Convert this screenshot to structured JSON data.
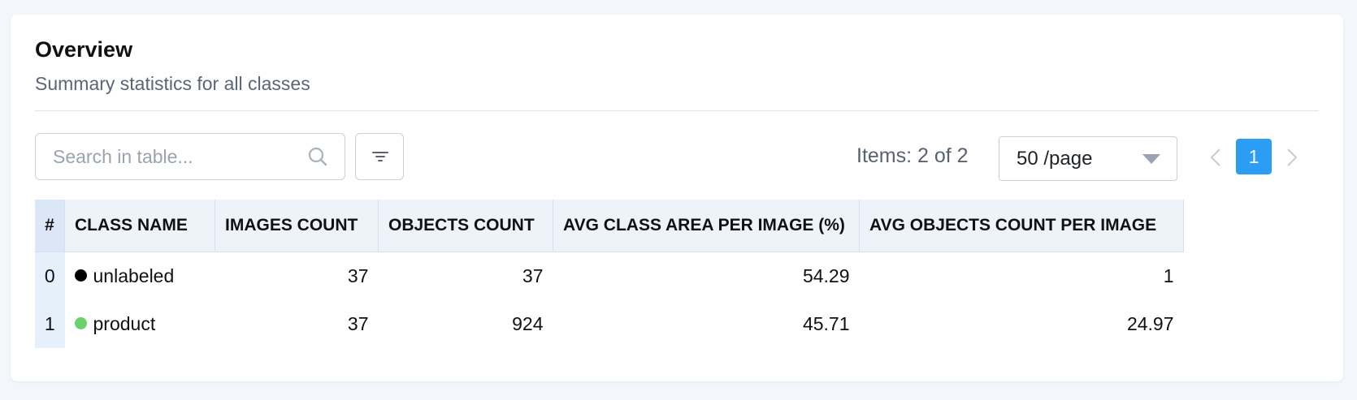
{
  "panel": {
    "title": "Overview",
    "subtitle": "Summary statistics for all classes"
  },
  "toolbar": {
    "search_placeholder": "Search in table...",
    "items_label": "Items: 2 of 2",
    "page_size": "50 /page",
    "current_page": "1"
  },
  "table": {
    "columns": {
      "index": "#",
      "class_name": "CLASS NAME",
      "images_count": "IMAGES COUNT",
      "objects_count": "OBJECTS COUNT",
      "avg_area": "AVG CLASS AREA PER IMAGE (%)",
      "avg_objects": "AVG OBJECTS COUNT PER IMAGE"
    },
    "rows": [
      {
        "index": "0",
        "class_name": "unlabeled",
        "color": "#000000",
        "images_count": "37",
        "objects_count": "37",
        "avg_area": "54.29",
        "avg_objects": "1"
      },
      {
        "index": "1",
        "class_name": "product",
        "color": "#6bd16b",
        "images_count": "37",
        "objects_count": "924",
        "avg_area": "45.71",
        "avg_objects": "24.97"
      }
    ]
  },
  "colors": {
    "accent": "#2b9df4",
    "header_bg": "#eef2f9",
    "index_bg": "#e6f0fa"
  },
  "icons": {
    "search": "search-icon",
    "filter": "filter-icon",
    "caret": "caret-down-icon",
    "prev": "chevron-left-icon",
    "next": "chevron-right-icon"
  }
}
